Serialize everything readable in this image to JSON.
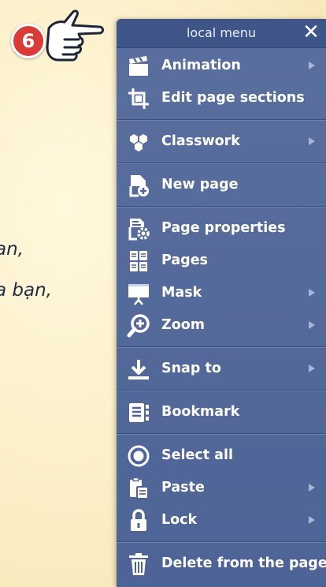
{
  "background": {
    "line1": "ạn,",
    "line2": "a bạn,"
  },
  "badge": {
    "number": "6"
  },
  "menu": {
    "title": "local menu",
    "close_icon": "close-icon",
    "items": [
      {
        "label": "Animation",
        "icon": "clapperboard-icon",
        "submenu": true
      },
      {
        "label": "Edit page sections",
        "icon": "crop-frame-icon",
        "submenu": false
      },
      {
        "label": "Classwork",
        "icon": "hexagons-icon",
        "submenu": true
      },
      {
        "label": "New page",
        "icon": "new-page-icon",
        "submenu": false
      },
      {
        "label": "Page properties",
        "icon": "page-settings-icon",
        "submenu": false
      },
      {
        "label": "Pages",
        "icon": "pages-grid-icon",
        "submenu": false
      },
      {
        "label": "Mask",
        "icon": "mask-screen-icon",
        "submenu": true
      },
      {
        "label": "Zoom",
        "icon": "zoom-in-icon",
        "submenu": true
      },
      {
        "label": "Snap to",
        "icon": "download-arrow-icon",
        "submenu": true
      },
      {
        "label": "Bookmark",
        "icon": "bookmark-icon",
        "submenu": false
      },
      {
        "label": "Select all",
        "icon": "radio-target-icon",
        "submenu": false
      },
      {
        "label": "Paste",
        "icon": "clipboard-icon",
        "submenu": true
      },
      {
        "label": "Lock",
        "icon": "lock-icon",
        "submenu": true
      },
      {
        "label": "Delete from the page",
        "icon": "trash-icon",
        "submenu": false
      }
    ]
  },
  "colors": {
    "menu_bg": "#5a6f9e",
    "header_bg": "#3f5587",
    "badge_red": "#d93c37",
    "background": "#fbeec6"
  }
}
